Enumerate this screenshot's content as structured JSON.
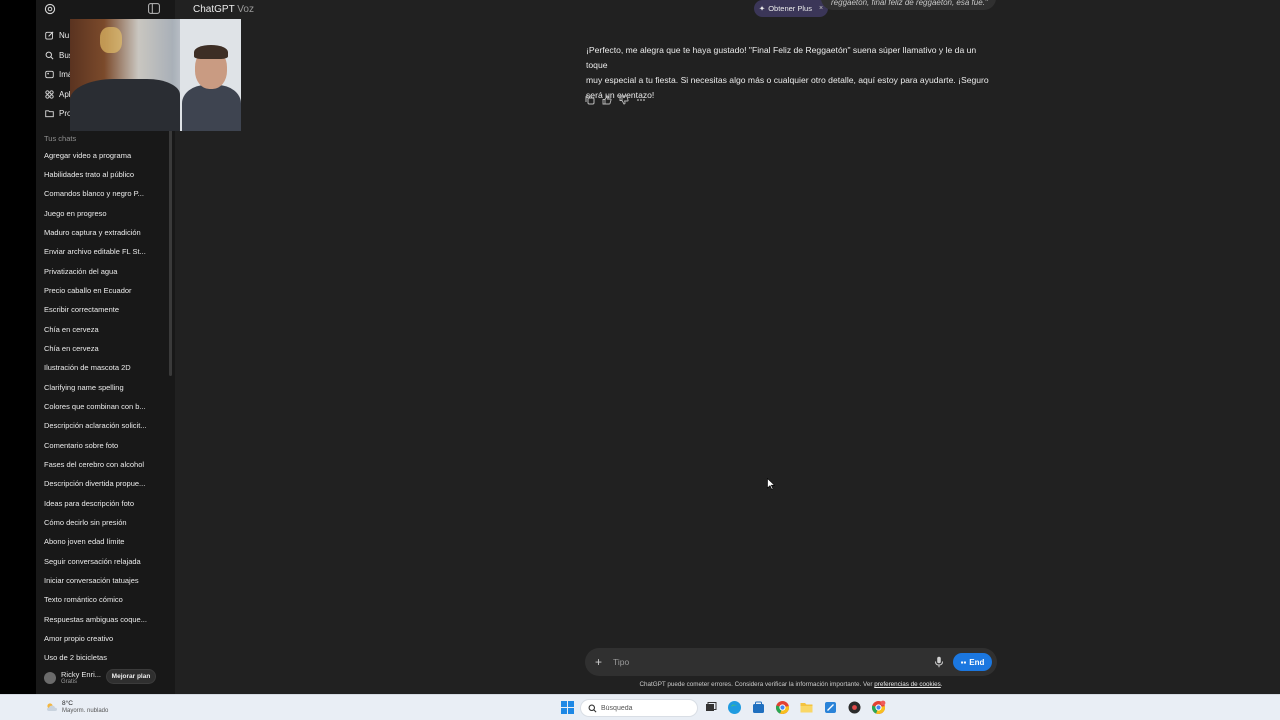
{
  "header": {
    "app_title": "ChatGPT",
    "app_subtitle": "Voz",
    "plus_button": "Obtener Plus",
    "plus_close": "×",
    "user_message": "reggaetón, final feliz de reggaetón, esa fue.\""
  },
  "sidebar": {
    "nav": [
      {
        "label": "Nu",
        "icon": "new-chat-icon"
      },
      {
        "label": "Bus",
        "icon": "search-icon"
      },
      {
        "label": "Imá",
        "icon": "image-icon"
      },
      {
        "label": "Apl",
        "icon": "apps-icon"
      },
      {
        "label": "Pro",
        "icon": "folder-icon"
      }
    ],
    "section_title": "Tus chats",
    "chats": [
      "Agregar video a programa",
      "Habilidades trato al público",
      "Comandos blanco y negro P...",
      "Juego en progreso",
      "Maduro captura y extradición",
      "Enviar archivo editable FL St...",
      "Privatización del agua",
      "Precio caballo en Ecuador",
      "Escribir correctamente",
      "Chía en cerveza",
      "Chía en cerveza",
      "Ilustración de mascota 2D",
      "Clarifying name spelling",
      "Colores que combinan con b...",
      "Descripción aclaración solicit...",
      "Comentario sobre foto",
      "Fases del cerebro con alcohol",
      "Descripción divertida propue...",
      "Ideas para descripción foto",
      "Cómo decirlo sin presión",
      "Abono joven edad límite",
      "Seguir conversación relajada",
      "Iniciar conversación tatuajes",
      "Texto romántico cómico",
      "Respuestas ambiguas coque...",
      "Amor propio creativo",
      "Uso de 2 bicicletas"
    ],
    "user": {
      "name": "Ricky Enri...",
      "plan": "Gratis",
      "upgrade_button": "Mejorar plan"
    }
  },
  "assistant_message": {
    "line1": "¡Perfecto, me alegra que te haya gustado! \"Final Feliz de Reggaetón\" suena súper llamativo y le da un toque",
    "line2": "muy especial a tu fiesta. Si necesitas algo más o cualquier otro detalle, aquí estoy para ayudarte. ¡Seguro",
    "line3": "será un eventazo!",
    "actions": [
      "copy-icon",
      "thumbs-up-icon",
      "thumbs-down-icon",
      "more-icon"
    ]
  },
  "composer": {
    "placeholder": "Tipo",
    "end_button": "End"
  },
  "disclaimer": {
    "text": "ChatGPT puede cometer errores. Considera verificar la información importante. Ver ",
    "link": "preferencias de cookies",
    "suffix": "."
  },
  "taskbar": {
    "weather_temp": "8°C",
    "weather_desc": "Mayorm. nublado",
    "search_placeholder": "Búsqueda",
    "apps": [
      "task-view-icon",
      "edge-icon",
      "store-icon",
      "chrome-icon",
      "file-explorer-icon",
      "snipping-tool-icon",
      "app-icon",
      "chrome-profile-icon"
    ]
  },
  "colors": {
    "background": "#212121",
    "sidebar": "#181818",
    "accent": "#1b77e0",
    "plus_badge": "#3b3658"
  }
}
